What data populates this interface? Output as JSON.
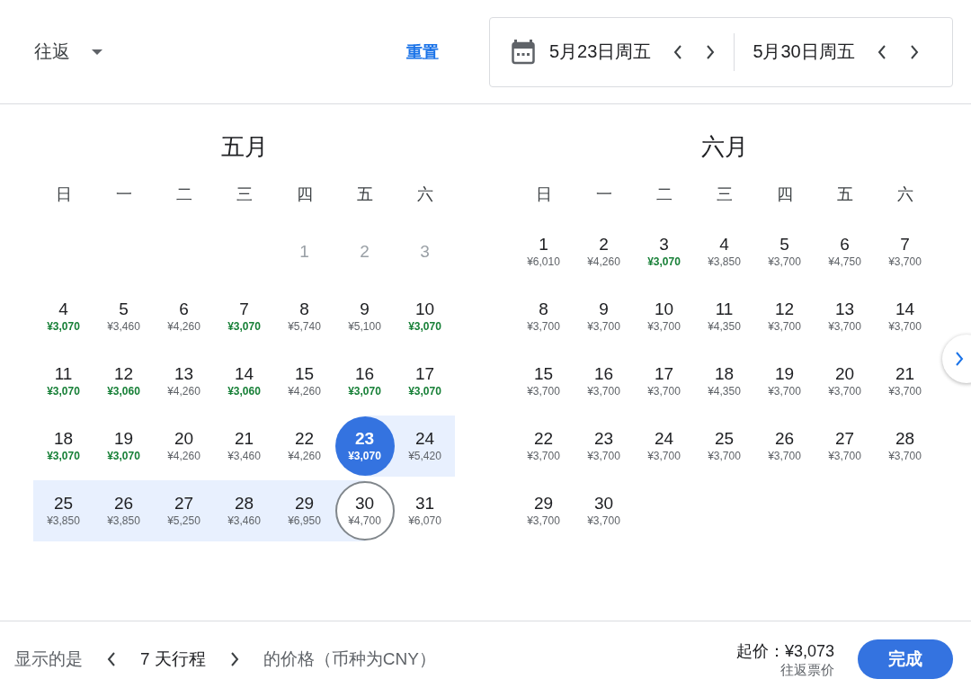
{
  "header": {
    "trip_type": "往返",
    "reset": "重置",
    "departure_date": "5月23日周五",
    "return_date": "5月30日周五"
  },
  "months": [
    {
      "title": "五月",
      "weekdays": [
        "日",
        "一",
        "二",
        "三",
        "四",
        "五",
        "六"
      ],
      "days": [
        {
          "kind": "blank"
        },
        {
          "kind": "blank"
        },
        {
          "kind": "blank"
        },
        {
          "kind": "blank"
        },
        {
          "kind": "day",
          "day": "1",
          "disabled": true,
          "selected": false,
          "outlined": false,
          "in_range": false
        },
        {
          "kind": "day",
          "day": "2",
          "disabled": true,
          "selected": false,
          "outlined": false,
          "in_range": false
        },
        {
          "kind": "day",
          "day": "3",
          "disabled": true,
          "selected": false,
          "outlined": false,
          "in_range": false
        },
        {
          "kind": "day",
          "day": "4",
          "price": "¥3,070",
          "cheap": true,
          "disabled": false,
          "selected": false,
          "outlined": false,
          "in_range": false
        },
        {
          "kind": "day",
          "day": "5",
          "price": "¥3,460",
          "cheap": false,
          "disabled": false,
          "selected": false,
          "outlined": false,
          "in_range": false
        },
        {
          "kind": "day",
          "day": "6",
          "price": "¥4,260",
          "cheap": false,
          "disabled": false,
          "selected": false,
          "outlined": false,
          "in_range": false
        },
        {
          "kind": "day",
          "day": "7",
          "price": "¥3,070",
          "cheap": true,
          "disabled": false,
          "selected": false,
          "outlined": false,
          "in_range": false
        },
        {
          "kind": "day",
          "day": "8",
          "price": "¥5,740",
          "cheap": false,
          "disabled": false,
          "selected": false,
          "outlined": false,
          "in_range": false
        },
        {
          "kind": "day",
          "day": "9",
          "price": "¥5,100",
          "cheap": false,
          "disabled": false,
          "selected": false,
          "outlined": false,
          "in_range": false
        },
        {
          "kind": "day",
          "day": "10",
          "price": "¥3,070",
          "cheap": true,
          "disabled": false,
          "selected": false,
          "outlined": false,
          "in_range": false
        },
        {
          "kind": "day",
          "day": "11",
          "price": "¥3,070",
          "cheap": true,
          "disabled": false,
          "selected": false,
          "outlined": false,
          "in_range": false
        },
        {
          "kind": "day",
          "day": "12",
          "price": "¥3,060",
          "cheap": true,
          "disabled": false,
          "selected": false,
          "outlined": false,
          "in_range": false
        },
        {
          "kind": "day",
          "day": "13",
          "price": "¥4,260",
          "cheap": false,
          "disabled": false,
          "selected": false,
          "outlined": false,
          "in_range": false
        },
        {
          "kind": "day",
          "day": "14",
          "price": "¥3,060",
          "cheap": true,
          "disabled": false,
          "selected": false,
          "outlined": false,
          "in_range": false
        },
        {
          "kind": "day",
          "day": "15",
          "price": "¥4,260",
          "cheap": false,
          "disabled": false,
          "selected": false,
          "outlined": false,
          "in_range": false
        },
        {
          "kind": "day",
          "day": "16",
          "price": "¥3,070",
          "cheap": true,
          "disabled": false,
          "selected": false,
          "outlined": false,
          "in_range": false
        },
        {
          "kind": "day",
          "day": "17",
          "price": "¥3,070",
          "cheap": true,
          "disabled": false,
          "selected": false,
          "outlined": false,
          "in_range": false
        },
        {
          "kind": "day",
          "day": "18",
          "price": "¥3,070",
          "cheap": true,
          "disabled": false,
          "selected": false,
          "outlined": false,
          "in_range": false
        },
        {
          "kind": "day",
          "day": "19",
          "price": "¥3,070",
          "cheap": true,
          "disabled": false,
          "selected": false,
          "outlined": false,
          "in_range": false
        },
        {
          "kind": "day",
          "day": "20",
          "price": "¥4,260",
          "cheap": false,
          "disabled": false,
          "selected": false,
          "outlined": false,
          "in_range": false
        },
        {
          "kind": "day",
          "day": "21",
          "price": "¥3,460",
          "cheap": false,
          "disabled": false,
          "selected": false,
          "outlined": false,
          "in_range": false
        },
        {
          "kind": "day",
          "day": "22",
          "price": "¥4,260",
          "cheap": false,
          "disabled": false,
          "selected": false,
          "outlined": false,
          "in_range": false
        },
        {
          "kind": "day",
          "day": "23",
          "price": "¥3,070",
          "disabled": false,
          "selected": true,
          "outlined": false,
          "in_range": true
        },
        {
          "kind": "day",
          "day": "24",
          "price": "¥5,420",
          "cheap": false,
          "disabled": false,
          "selected": false,
          "outlined": false,
          "in_range": true
        },
        {
          "kind": "day",
          "day": "25",
          "price": "¥3,850",
          "cheap": false,
          "disabled": false,
          "selected": false,
          "outlined": false,
          "in_range": true
        },
        {
          "kind": "day",
          "day": "26",
          "price": "¥3,850",
          "cheap": false,
          "disabled": false,
          "selected": false,
          "outlined": false,
          "in_range": true
        },
        {
          "kind": "day",
          "day": "27",
          "price": "¥5,250",
          "cheap": false,
          "disabled": false,
          "selected": false,
          "outlined": false,
          "in_range": true
        },
        {
          "kind": "day",
          "day": "28",
          "price": "¥3,460",
          "cheap": false,
          "disabled": false,
          "selected": false,
          "outlined": false,
          "in_range": true
        },
        {
          "kind": "day",
          "day": "29",
          "price": "¥6,950",
          "cheap": false,
          "disabled": false,
          "selected": false,
          "outlined": false,
          "in_range": true
        },
        {
          "kind": "day",
          "day": "30",
          "price": "¥4,700",
          "cheap": false,
          "disabled": false,
          "selected": false,
          "outlined": true,
          "in_range": true
        },
        {
          "kind": "day",
          "day": "31",
          "price": "¥6,070",
          "cheap": false,
          "disabled": false,
          "selected": false,
          "outlined": false,
          "in_range": false
        }
      ]
    },
    {
      "title": "六月",
      "weekdays": [
        "日",
        "一",
        "二",
        "三",
        "四",
        "五",
        "六"
      ],
      "days": [
        {
          "kind": "day",
          "day": "1",
          "price": "¥6,010",
          "cheap": false,
          "disabled": false,
          "selected": false,
          "outlined": false,
          "in_range": false
        },
        {
          "kind": "day",
          "day": "2",
          "price": "¥4,260",
          "cheap": false,
          "disabled": false,
          "selected": false,
          "outlined": false,
          "in_range": false
        },
        {
          "kind": "day",
          "day": "3",
          "price": "¥3,070",
          "cheap": true,
          "disabled": false,
          "selected": false,
          "outlined": false,
          "in_range": false
        },
        {
          "kind": "day",
          "day": "4",
          "price": "¥3,850",
          "cheap": false,
          "disabled": false,
          "selected": false,
          "outlined": false,
          "in_range": false
        },
        {
          "kind": "day",
          "day": "5",
          "price": "¥3,700",
          "cheap": false,
          "disabled": false,
          "selected": false,
          "outlined": false,
          "in_range": false
        },
        {
          "kind": "day",
          "day": "6",
          "price": "¥4,750",
          "cheap": false,
          "disabled": false,
          "selected": false,
          "outlined": false,
          "in_range": false
        },
        {
          "kind": "day",
          "day": "7",
          "price": "¥3,700",
          "cheap": false,
          "disabled": false,
          "selected": false,
          "outlined": false,
          "in_range": false
        },
        {
          "kind": "day",
          "day": "8",
          "price": "¥3,700",
          "cheap": false,
          "disabled": false,
          "selected": false,
          "outlined": false,
          "in_range": false
        },
        {
          "kind": "day",
          "day": "9",
          "price": "¥3,700",
          "cheap": false,
          "disabled": false,
          "selected": false,
          "outlined": false,
          "in_range": false
        },
        {
          "kind": "day",
          "day": "10",
          "price": "¥3,700",
          "cheap": false,
          "disabled": false,
          "selected": false,
          "outlined": false,
          "in_range": false
        },
        {
          "kind": "day",
          "day": "11",
          "price": "¥4,350",
          "cheap": false,
          "disabled": false,
          "selected": false,
          "outlined": false,
          "in_range": false
        },
        {
          "kind": "day",
          "day": "12",
          "price": "¥3,700",
          "cheap": false,
          "disabled": false,
          "selected": false,
          "outlined": false,
          "in_range": false
        },
        {
          "kind": "day",
          "day": "13",
          "price": "¥3,700",
          "cheap": false,
          "disabled": false,
          "selected": false,
          "outlined": false,
          "in_range": false
        },
        {
          "kind": "day",
          "day": "14",
          "price": "¥3,700",
          "cheap": false,
          "disabled": false,
          "selected": false,
          "outlined": false,
          "in_range": false
        },
        {
          "kind": "day",
          "day": "15",
          "price": "¥3,700",
          "cheap": false,
          "disabled": false,
          "selected": false,
          "outlined": false,
          "in_range": false
        },
        {
          "kind": "day",
          "day": "16",
          "price": "¥3,700",
          "cheap": false,
          "disabled": false,
          "selected": false,
          "outlined": false,
          "in_range": false
        },
        {
          "kind": "day",
          "day": "17",
          "price": "¥3,700",
          "cheap": false,
          "disabled": false,
          "selected": false,
          "outlined": false,
          "in_range": false
        },
        {
          "kind": "day",
          "day": "18",
          "price": "¥4,350",
          "cheap": false,
          "disabled": false,
          "selected": false,
          "outlined": false,
          "in_range": false
        },
        {
          "kind": "day",
          "day": "19",
          "price": "¥3,700",
          "cheap": false,
          "disabled": false,
          "selected": false,
          "outlined": false,
          "in_range": false
        },
        {
          "kind": "day",
          "day": "20",
          "price": "¥3,700",
          "cheap": false,
          "disabled": false,
          "selected": false,
          "outlined": false,
          "in_range": false
        },
        {
          "kind": "day",
          "day": "21",
          "price": "¥3,700",
          "cheap": false,
          "disabled": false,
          "selected": false,
          "outlined": false,
          "in_range": false
        },
        {
          "kind": "day",
          "day": "22",
          "price": "¥3,700",
          "cheap": false,
          "disabled": false,
          "selected": false,
          "outlined": false,
          "in_range": false
        },
        {
          "kind": "day",
          "day": "23",
          "price": "¥3,700",
          "cheap": false,
          "disabled": false,
          "selected": false,
          "outlined": false,
          "in_range": false
        },
        {
          "kind": "day",
          "day": "24",
          "price": "¥3,700",
          "cheap": false,
          "disabled": false,
          "selected": false,
          "outlined": false,
          "in_range": false
        },
        {
          "kind": "day",
          "day": "25",
          "price": "¥3,700",
          "cheap": false,
          "disabled": false,
          "selected": false,
          "outlined": false,
          "in_range": false
        },
        {
          "kind": "day",
          "day": "26",
          "price": "¥3,700",
          "cheap": false,
          "disabled": false,
          "selected": false,
          "outlined": false,
          "in_range": false
        },
        {
          "kind": "day",
          "day": "27",
          "price": "¥3,700",
          "cheap": false,
          "disabled": false,
          "selected": false,
          "outlined": false,
          "in_range": false
        },
        {
          "kind": "day",
          "day": "28",
          "price": "¥3,700",
          "cheap": false,
          "disabled": false,
          "selected": false,
          "outlined": false,
          "in_range": false
        },
        {
          "kind": "day",
          "day": "29",
          "price": "¥3,700",
          "cheap": false,
          "disabled": false,
          "selected": false,
          "outlined": false,
          "in_range": false
        },
        {
          "kind": "day",
          "day": "30",
          "price": "¥3,700",
          "cheap": false,
          "disabled": false,
          "selected": false,
          "outlined": false,
          "in_range": false
        }
      ]
    }
  ],
  "footer": {
    "prefix": "显示的是",
    "duration": "7 天行程",
    "suffix": "的价格（币种为CNY）",
    "lowest_price": "起价：¥3,073",
    "price_note": "往返票价",
    "done": "完成"
  }
}
